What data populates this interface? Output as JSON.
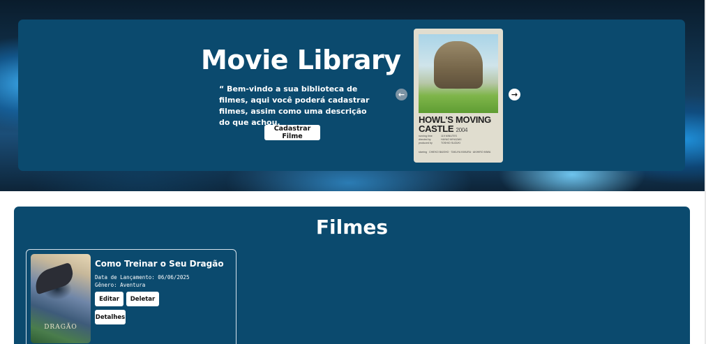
{
  "hero": {
    "title": "Movie Library",
    "description": "“ Bem-vindo a sua biblioteca de filmes, aqui você poderá cadastrar filmes, assim como uma descrição do que achou.",
    "register_button": "Cadastrar Filme",
    "carousel": {
      "prev_icon": "arrow-left-icon",
      "next_icon": "arrow-right-icon",
      "poster": {
        "title": "HOWL'S MOVING CASTLE",
        "year": "2004",
        "credits": [
          {
            "label": "running time",
            "value": "119 MINUTES"
          },
          {
            "label": "directed by",
            "value": "HAYAO MIYAZAKI"
          },
          {
            "label": "produced by",
            "value": "TOSHIO SUZUKI"
          }
        ],
        "starring_label": "starring",
        "starring": "CHIEKO BAISHO · TAKUYA KIMURA · AKIHIRO MIWA"
      }
    }
  },
  "films": {
    "title": "Filmes",
    "items": [
      {
        "name": "Como Treinar o Seu Dragão",
        "release": "Data de Lançamento: 06/06/2025",
        "genre": "Gênero: Aventura",
        "poster_text": "DRAGÃO",
        "buttons": {
          "edit": "Editar",
          "delete": "Deletar",
          "details": "Detalhes"
        }
      }
    ]
  },
  "colors": {
    "panel": "#0b4a6e",
    "button_bg": "#ffffff",
    "text": "#ffffff"
  }
}
